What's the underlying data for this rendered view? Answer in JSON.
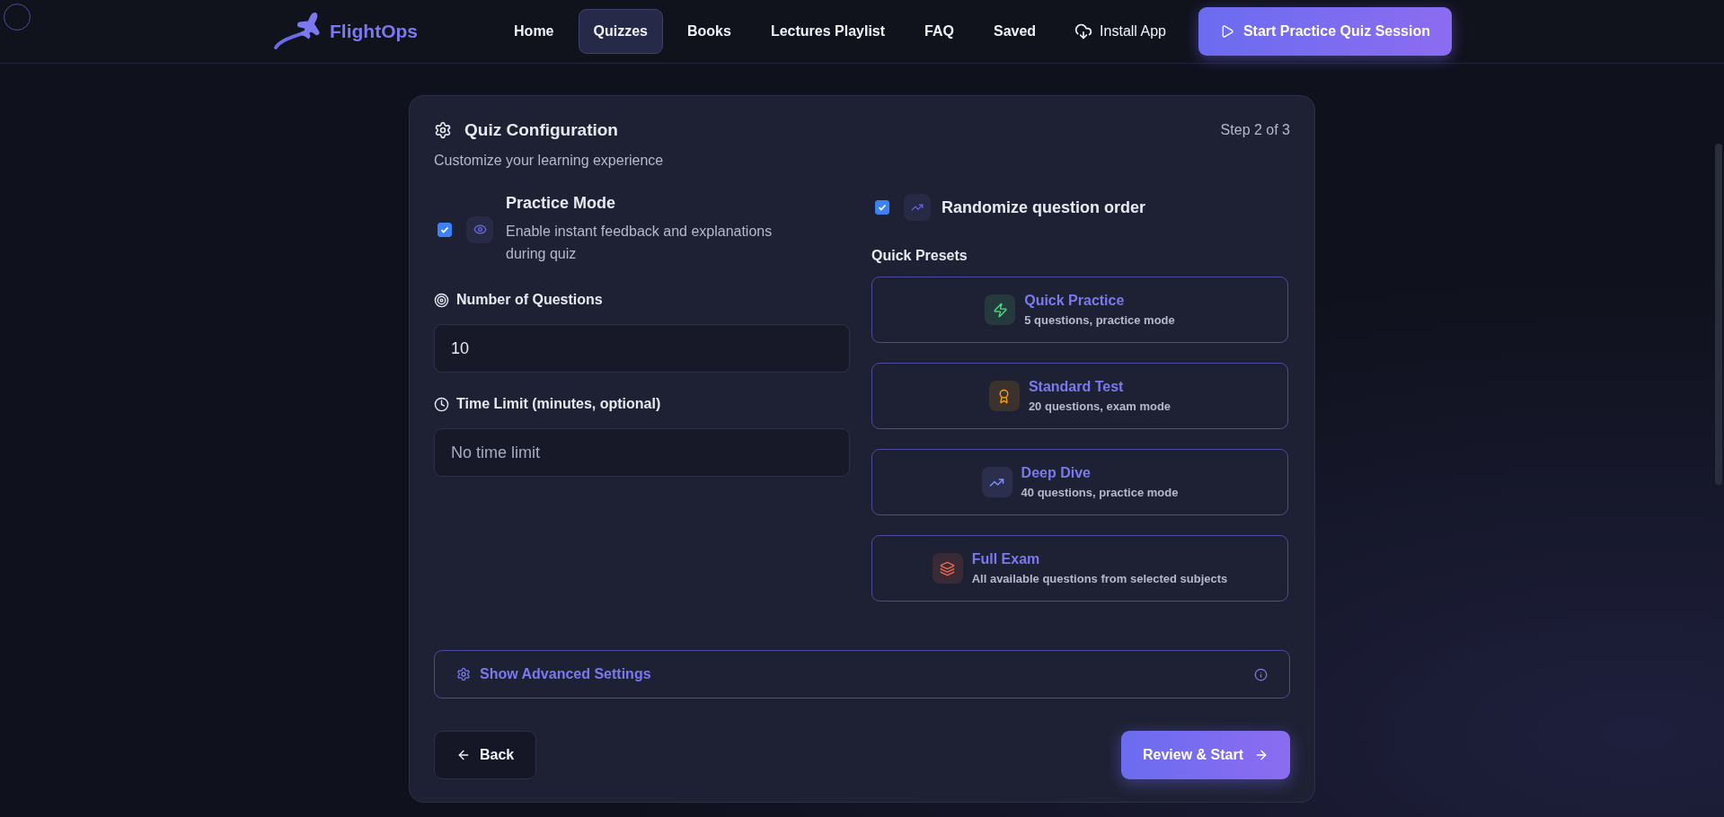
{
  "brand": "FlightOps",
  "nav": [
    {
      "label": "Home",
      "selected": false
    },
    {
      "label": "Quizzes",
      "selected": true
    },
    {
      "label": "Books",
      "selected": false
    },
    {
      "label": "Lectures Playlist",
      "selected": false
    },
    {
      "label": "FAQ",
      "selected": false
    },
    {
      "label": "Saved",
      "selected": false
    }
  ],
  "install": "Install App",
  "cta": "Start Practice Quiz Session",
  "card": {
    "title": "Quiz Configuration",
    "step": "Step 2 of 3",
    "subtitle": "Customize your learning experience"
  },
  "practice_mode": {
    "label": "Practice Mode",
    "description": "Enable instant feedback and explanations during quiz",
    "checked": true
  },
  "randomize": {
    "label": "Randomize question order",
    "checked": true
  },
  "questions": {
    "label": "Number of Questions",
    "value": "10"
  },
  "time_limit": {
    "label": "Time Limit (minutes, optional)",
    "placeholder": "No time limit"
  },
  "presets_title": "Quick Presets",
  "presets": [
    {
      "title": "Quick Practice",
      "detail": "5 questions, practice mode",
      "color": "#4ade80"
    },
    {
      "title": "Standard Test",
      "detail": "20 questions, exam mode",
      "color": "#f59e0b"
    },
    {
      "title": "Deep Dive",
      "detail": "40 questions, practice mode",
      "color": "#818cf8"
    },
    {
      "title": "Full Exam",
      "detail": "All available questions from selected subjects",
      "color": "#ef6a4a"
    }
  ],
  "advanced": "Show Advanced Settings",
  "back": "Back",
  "next": "Review & Start"
}
